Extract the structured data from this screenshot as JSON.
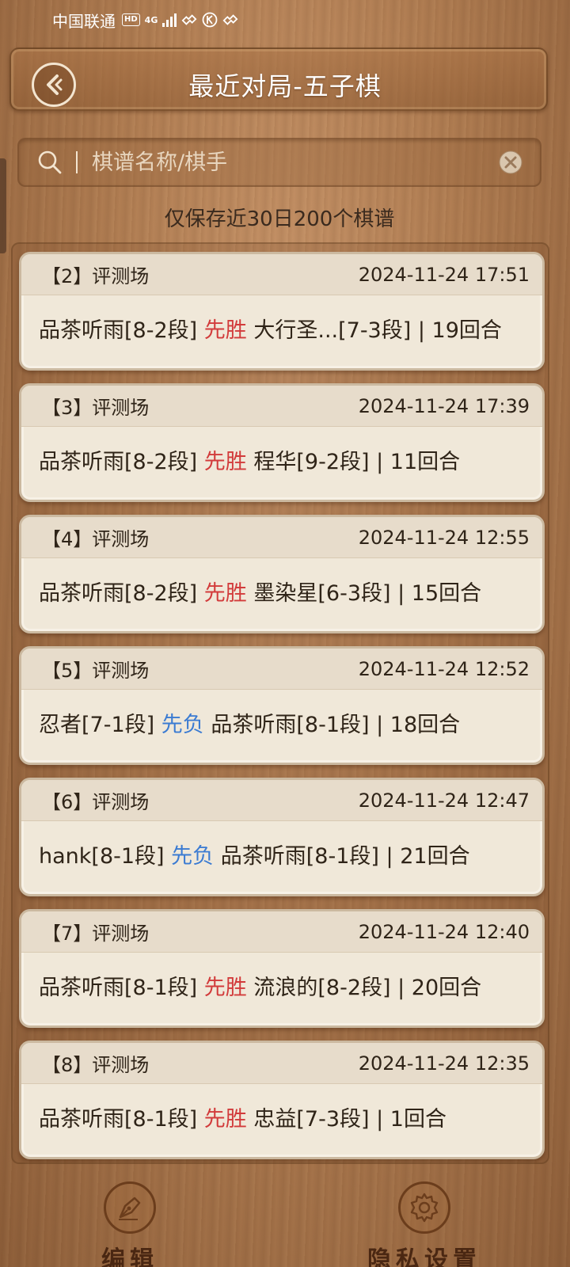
{
  "status_bar": {
    "carrier": "中国联通",
    "hd": "HD",
    "network": "4G"
  },
  "header": {
    "title": "最近对局-五子棋"
  },
  "search": {
    "placeholder": "棋谱名称/棋手",
    "value": ""
  },
  "retention_note": "仅保存近30日200个棋谱",
  "records": [
    {
      "index": "【2】",
      "venue": "评测场",
      "time": "2024-11-24 17:51",
      "player1": "品茶听雨[8-2段]",
      "result": "先胜",
      "result_type": "win",
      "player2": "大行圣...[7-3段]",
      "rounds": "| 19回合"
    },
    {
      "index": "【3】",
      "venue": "评测场",
      "time": "2024-11-24 17:39",
      "player1": "品茶听雨[8-2段]",
      "result": "先胜",
      "result_type": "win",
      "player2": "程华[9-2段]",
      "rounds": "| 11回合"
    },
    {
      "index": "【4】",
      "venue": "评测场",
      "time": "2024-11-24 12:55",
      "player1": "品茶听雨[8-2段]",
      "result": "先胜",
      "result_type": "win",
      "player2": "墨染星[6-3段]",
      "rounds": "| 15回合"
    },
    {
      "index": "【5】",
      "venue": "评测场",
      "time": "2024-11-24 12:52",
      "player1": "忍者[7-1段]",
      "result": "先负",
      "result_type": "lose",
      "player2": "品茶听雨[8-1段]",
      "rounds": "| 18回合"
    },
    {
      "index": "【6】",
      "venue": "评测场",
      "time": "2024-11-24 12:47",
      "player1": "hank[8-1段]",
      "result": "先负",
      "result_type": "lose",
      "player2": "品茶听雨[8-1段]",
      "rounds": "| 21回合"
    },
    {
      "index": "【7】",
      "venue": "评测场",
      "time": "2024-11-24 12:40",
      "player1": "品茶听雨[8-1段]",
      "result": "先胜",
      "result_type": "win",
      "player2": "流浪的[8-2段]",
      "rounds": "| 20回合"
    },
    {
      "index": "【8】",
      "venue": "评测场",
      "time": "2024-11-24 12:35",
      "player1": "品茶听雨[8-1段]",
      "result": "先胜",
      "result_type": "win",
      "player2": "忠益[7-3段]",
      "rounds": "| 1回合"
    }
  ],
  "bottom_nav": {
    "edit_label": "编辑",
    "privacy_label": "隐私设置"
  },
  "colors": {
    "win": "#d23b3b",
    "lose": "#3b7bd2",
    "card_bg": "#f0e8d9"
  },
  "icons": {
    "back": "back-arrow-icon",
    "search": "search-icon",
    "clear": "clear-icon",
    "edit": "pen-nib-icon",
    "privacy": "gear-icon"
  }
}
